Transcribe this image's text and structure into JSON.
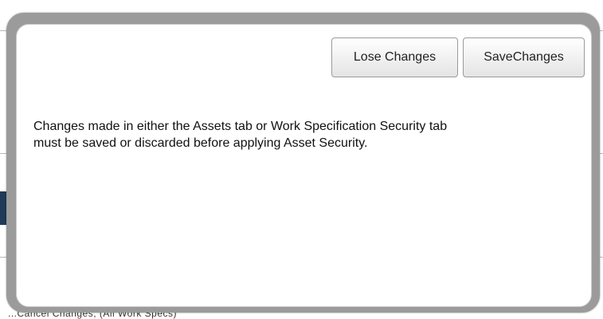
{
  "background": {
    "partial_text": "...Cancel Changes; (All Work Specs)"
  },
  "dialog": {
    "lose_changes_label": "Lose Changes",
    "save_changes_label": "SaveChanges",
    "message_line1": "Changes made in either the Assets tab or Work Specification Security tab",
    "message_line2": "must be saved or discarded before applying Asset Security."
  },
  "colors": {
    "frame": "#9b9b9b",
    "panel": "#ffffff",
    "button_border": "#9a9a9a"
  }
}
